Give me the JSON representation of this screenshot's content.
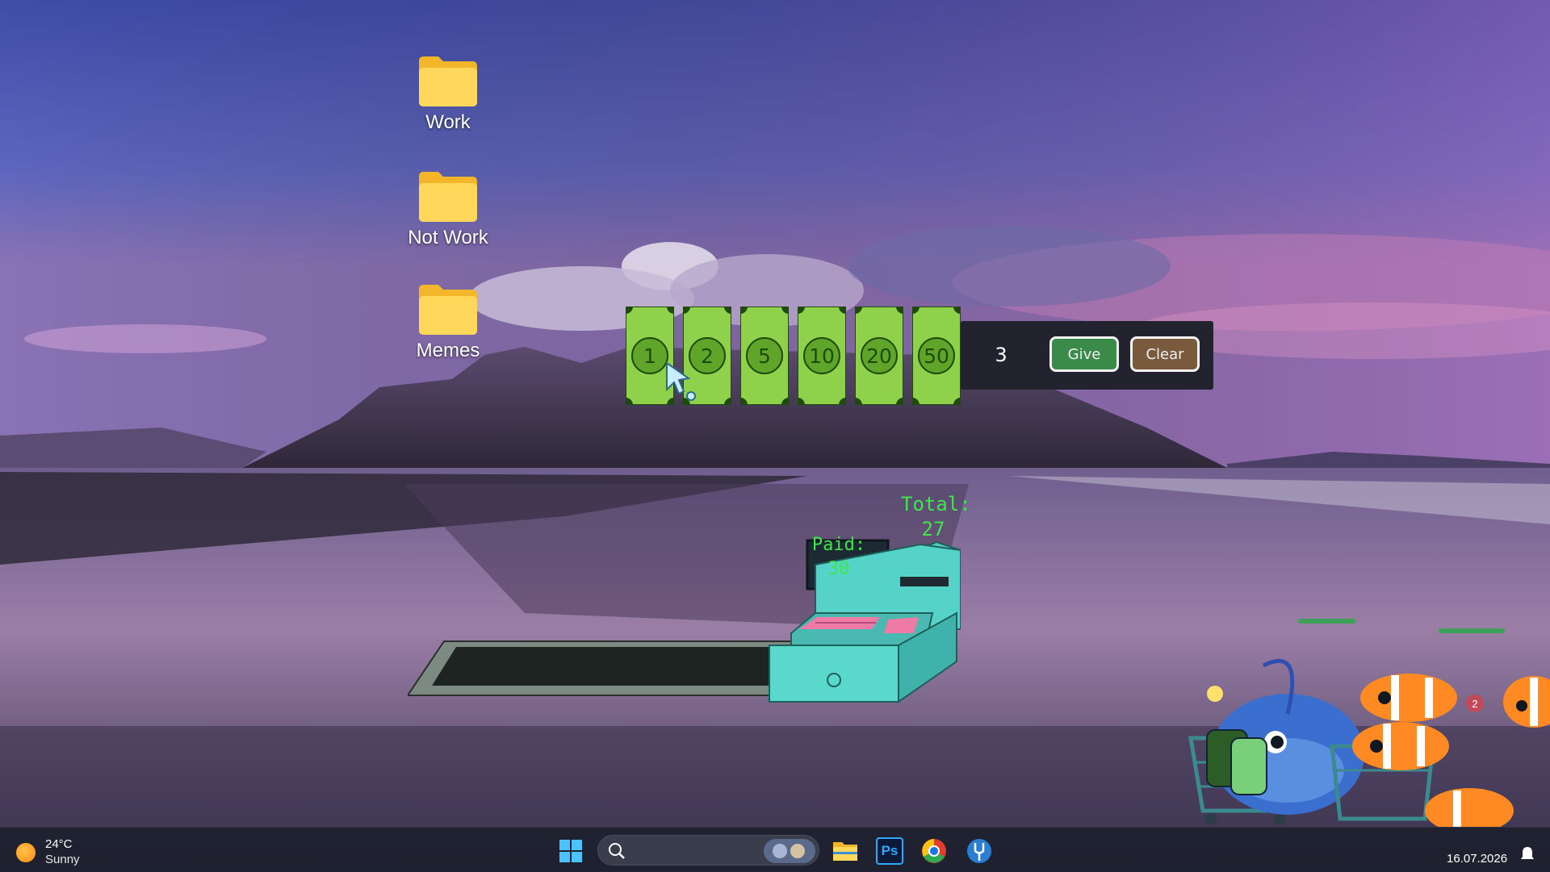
{
  "desktop": {
    "icons": [
      {
        "label": "Work"
      },
      {
        "label": "Not Work"
      },
      {
        "label": "Memes"
      }
    ]
  },
  "game": {
    "bills": [
      "1",
      "2",
      "5",
      "10",
      "20",
      "50"
    ],
    "amount": "3",
    "give_label": "Give",
    "clear_label": "Clear",
    "total_label": "Total:",
    "total_value": "27",
    "paid_label": "Paid:",
    "paid_value": "30",
    "colors": {
      "bill": "#8fd14a",
      "give": "#3a8a4a",
      "clear": "#7a5a3c",
      "register": "#4ecdc4",
      "text_green": "#3ee64c"
    }
  },
  "taskbar": {
    "weather_temp": "24°C",
    "weather_condition": "Sunny",
    "clock_date": "16.07.2026",
    "tray_badge": "2",
    "icons": [
      "start-icon",
      "search-icon",
      "file-explorer-icon",
      "photoshop-icon",
      "chrome-icon",
      "tuning-fork-icon"
    ],
    "photoshop_label": "Ps"
  }
}
